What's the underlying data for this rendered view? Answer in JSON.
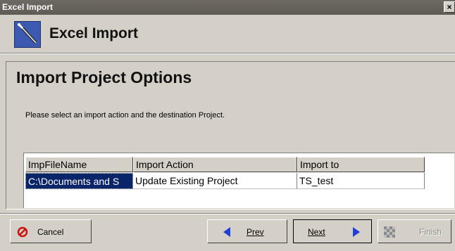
{
  "window": {
    "title": "Excel Import",
    "close_glyph": "×"
  },
  "header": {
    "title": "Excel Import",
    "icon": "wand-icon"
  },
  "panel": {
    "heading": "Import Project Options",
    "instructions": "Please select an import action and the destination Project."
  },
  "table": {
    "columns": [
      "ImpFileName",
      "Import Action",
      "Import to"
    ],
    "rows": [
      [
        "C:\\Documents and S",
        "Update Existing Project",
        "TS_test"
      ]
    ]
  },
  "buttons": {
    "cancel": {
      "label": "Cancel",
      "icon": "cancel-icon"
    },
    "prev": {
      "label": "Prev",
      "icon": "left-arrow-icon"
    },
    "next": {
      "label": "Next",
      "icon": "right-arrow-icon"
    },
    "finish": {
      "label": "Finish",
      "icon": "finish-icon",
      "disabled": true
    }
  },
  "colors": {
    "selection": "#0a246a",
    "arrow": "#1f3fd6",
    "cancel_icon": "#cc1111"
  }
}
